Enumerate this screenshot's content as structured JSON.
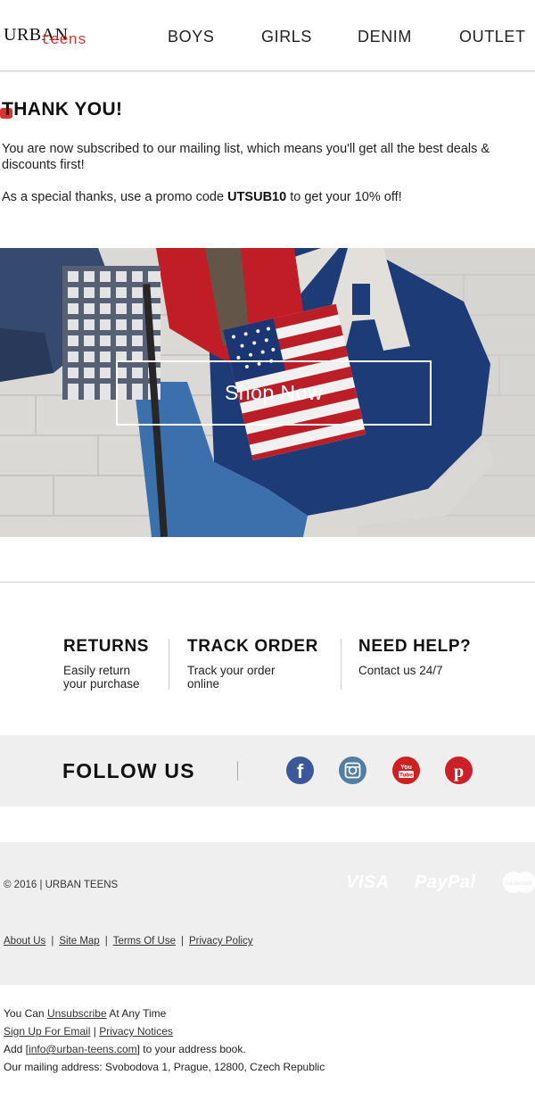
{
  "header": {
    "logo_main": "URBAN",
    "logo_sub": "teens",
    "nav": [
      "BOYS",
      "GIRLS",
      "DENIM",
      "OUTLET"
    ]
  },
  "thank_you": {
    "title": "THANK YOU!",
    "line1": "You are now subscribed to our mailing list, which means you'll get all the best deals & discounts first!",
    "line2_prefix": "As a special thanks, use a promo code ",
    "promo_code": "UTSUB10",
    "line2_suffix": " to get your 10% off!"
  },
  "hero": {
    "button_label": "Shop Now"
  },
  "services": [
    {
      "title": "RETURNS",
      "text": "Easily return your purchase"
    },
    {
      "title": "TRACK ORDER",
      "text": "Track your order online"
    },
    {
      "title": "NEED HELP?",
      "text": "Contact us 24/7"
    }
  ],
  "follow": {
    "label": "FOLLOW US",
    "icons": [
      "facebook-icon",
      "instagram-icon",
      "youtube-icon",
      "pinterest-icon"
    ],
    "youtube_text": "You Tube"
  },
  "footer": {
    "copyright": "© 2016 | URBAN TEENS",
    "payments": [
      "VISA",
      "PayPal",
      "mastercard"
    ],
    "links": [
      "About Us",
      "Site Map",
      "Terms Of Use",
      "Privacy Policy"
    ]
  },
  "bottom": {
    "unsub_prefix": "You Can ",
    "unsub_link": "Unsubscribe",
    "unsub_suffix": " At Any Time",
    "signup_link": "Sign Up For Email",
    "separator": "|",
    "privacy_link": "Privacy Notices",
    "add_prefix": "Add [",
    "email": "info@urban-teens.com",
    "add_suffix": "] to your address book.",
    "address": "Our mailing address: Svobodova 1, Prague, 12800, Czech Republic"
  },
  "colors": {
    "brand_red": "#d8352a",
    "facebook": "#3b5998",
    "instagram": "#517fa4",
    "youtube": "#cd201f",
    "pinterest": "#cb2027"
  }
}
